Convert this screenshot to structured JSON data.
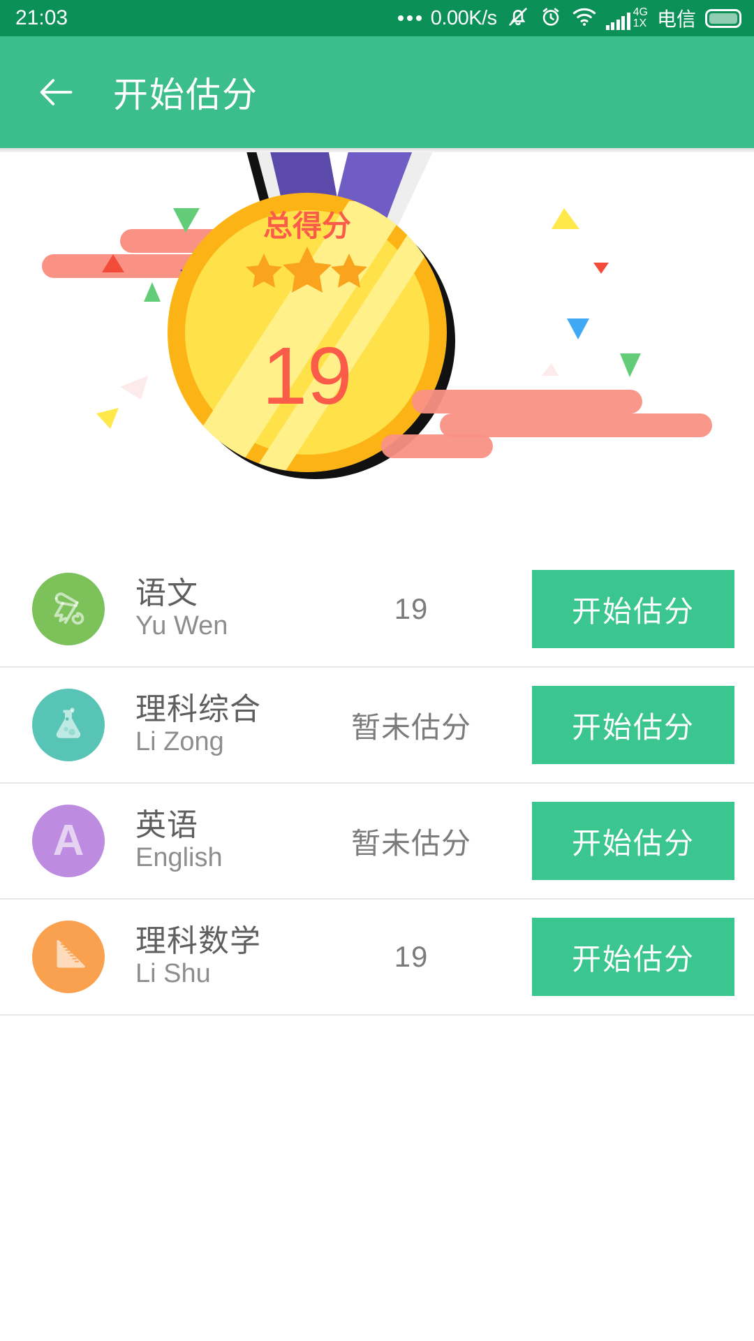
{
  "status_bar": {
    "time": "21:03",
    "network_speed": "0.00K/s",
    "network_generation": "4G",
    "network_sub": "1X",
    "carrier": "电信",
    "icons": [
      "more-dots-icon",
      "mute-bell-icon",
      "alarm-clock-icon",
      "wifi-icon",
      "signal-bars-icon",
      "battery-icon"
    ],
    "background_color": "#0b9158"
  },
  "app_bar": {
    "title": "开始估分",
    "back_icon": "back-arrow-icon",
    "background_color": "#3cbd8c"
  },
  "hero": {
    "medal_label": "总得分",
    "total_score": "19",
    "star_count": 3,
    "colors": {
      "medal_gold_rim": "#fcb316",
      "medal_face": "#ffe24a",
      "medal_shine": "#fff089",
      "ribbon_purple": "#5c4aab",
      "ribbon_purple_light": "#6f5cc4",
      "ribbon_white": "#eeeeee",
      "label_red": "#fb5c4a",
      "star_orange": "#f9a41c",
      "confetti_salmon": "#fa9185"
    },
    "confetti": [
      {
        "name": "green-triangle-down",
        "color": "#63cc78"
      },
      {
        "name": "red-triangle-up",
        "color": "#f24b3a"
      },
      {
        "name": "purple-triangle-down",
        "color": "#5e4ab8"
      },
      {
        "name": "green-triangle-up",
        "color": "#63cc78"
      },
      {
        "name": "yellow-triangle-left",
        "color": "#ffe84a"
      },
      {
        "name": "pink-triangle-down",
        "color": "#fdeaea"
      },
      {
        "name": "yellow-triangle-right",
        "color": "#ffe84a"
      },
      {
        "name": "blue-triangle-down",
        "color": "#3fa9f5"
      },
      {
        "name": "pink-triangle-up",
        "color": "#fdeaea"
      }
    ]
  },
  "subjects": {
    "button_label": "开始估分",
    "rows": [
      {
        "icon_name": "scroll-icon",
        "icon_bg": "#7cc159",
        "name_cn": "语文",
        "name_en": "Yu Wen",
        "score": "19",
        "button_label": "开始估分"
      },
      {
        "icon_name": "flask-icon",
        "icon_bg": "#57c4b5",
        "name_cn": "理科综合",
        "name_en": "Li Zong",
        "score": "暂未估分",
        "button_label": "开始估分"
      },
      {
        "icon_name": "letter-a-icon",
        "icon_bg": "#bd8ce0",
        "name_cn": "英语",
        "name_en": "English",
        "score": "暂未估分",
        "button_label": "开始估分"
      },
      {
        "icon_name": "ruler-triangle-icon",
        "icon_bg": "#f9a14e",
        "name_cn": "理科数学",
        "name_en": "Li Shu",
        "score": "19",
        "button_label": "开始估分"
      }
    ]
  }
}
